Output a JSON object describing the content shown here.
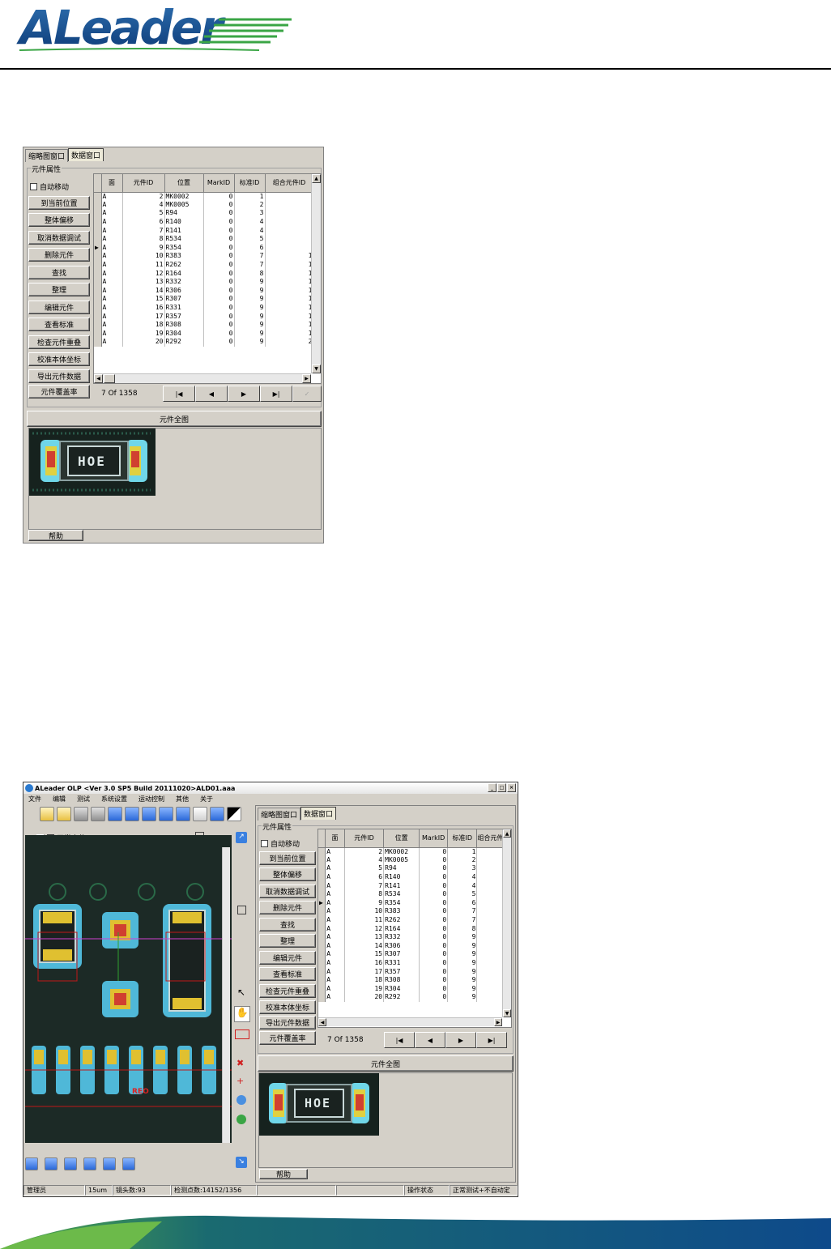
{
  "header": {
    "logo_text": "ALeader"
  },
  "panel": {
    "tabs": [
      "缩略图窗口",
      "数据窗口"
    ],
    "group_title": "元件属性",
    "auto_move_label": "自动移动",
    "buttons": [
      "到当前位置",
      "整体偏移",
      "取消数据调试",
      "删除元件",
      "查找",
      "整理",
      "编辑元件",
      "查看标准",
      "检查元件重叠",
      "校准本体坐标",
      "导出元件数据",
      "元件覆盖率"
    ],
    "table": {
      "columns": [
        "面",
        "元件ID",
        "位置",
        "MarkID",
        "标准ID",
        "组合元件ID"
      ],
      "rows": [
        [
          "A",
          "2",
          "MK0002",
          "0",
          "1",
          ""
        ],
        [
          "A",
          "4",
          "MK0005",
          "0",
          "2",
          ""
        ],
        [
          "A",
          "5",
          "R94",
          "0",
          "3",
          ""
        ],
        [
          "A",
          "6",
          "R140",
          "0",
          "4",
          ""
        ],
        [
          "A",
          "7",
          "R141",
          "0",
          "4",
          ""
        ],
        [
          "A",
          "8",
          "R534",
          "0",
          "5",
          ""
        ],
        [
          "A",
          "9",
          "R354",
          "0",
          "6",
          ""
        ],
        [
          "A",
          "10",
          "R383",
          "0",
          "7",
          "1"
        ],
        [
          "A",
          "11",
          "R262",
          "0",
          "7",
          "1"
        ],
        [
          "A",
          "12",
          "R164",
          "0",
          "8",
          "1"
        ],
        [
          "A",
          "13",
          "R332",
          "0",
          "9",
          "1"
        ],
        [
          "A",
          "14",
          "R306",
          "0",
          "9",
          "1"
        ],
        [
          "A",
          "15",
          "R307",
          "0",
          "9",
          "1"
        ],
        [
          "A",
          "16",
          "R331",
          "0",
          "9",
          "1"
        ],
        [
          "A",
          "17",
          "R357",
          "0",
          "9",
          "1"
        ],
        [
          "A",
          "18",
          "R308",
          "0",
          "9",
          "1"
        ],
        [
          "A",
          "19",
          "R304",
          "0",
          "9",
          "1"
        ],
        [
          "A",
          "20",
          "R292",
          "0",
          "9",
          "2"
        ]
      ],
      "current_row_index": 6
    },
    "record_nav": {
      "position_text": "7 Of  1358"
    },
    "full_view_button": "元件全图",
    "component_marking": "HOE",
    "help_label": "帮助"
  },
  "app": {
    "title": "ALeader OLP  <Ver 3.0 SP5  Build 20111020>ALD01.aaa",
    "menu": [
      "文件",
      "编辑",
      "测试",
      "系统设置",
      "运动控制",
      "其他",
      "关于"
    ],
    "zoom_value": "90",
    "normal_locate_label": "正常定位",
    "board_label": "REO",
    "status": [
      "管理员",
      "15um",
      "镜头数:93",
      "检测点数:14152/1356",
      "",
      "",
      "操作状态",
      "正常测试+不自动定"
    ]
  }
}
